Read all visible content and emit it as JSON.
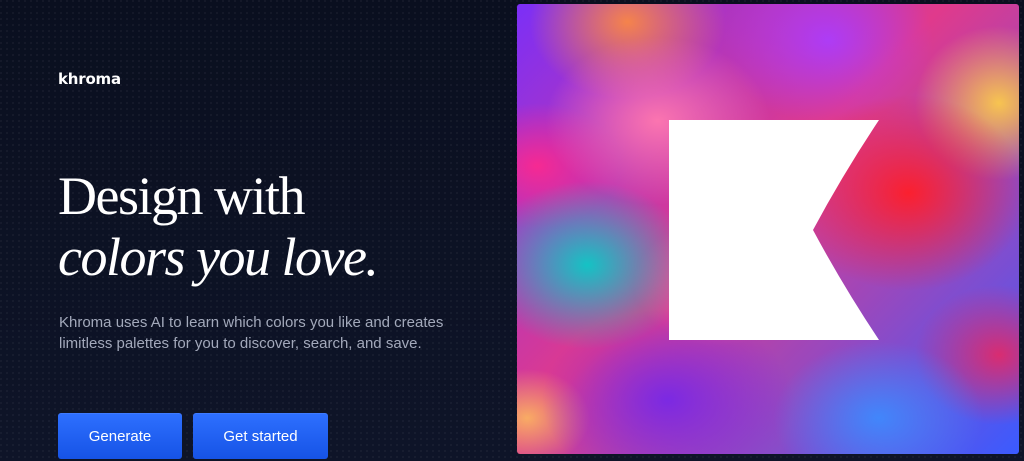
{
  "header": {
    "logo_text": "khroma"
  },
  "hero": {
    "headline_line1": "Design with",
    "headline_line2": "colors you love.",
    "description": "Khroma uses AI to learn which colors you like and creates limitless palettes for you to discover, search, and save.",
    "buttons": {
      "generate_label": "Generate",
      "get_started_label": "Get started"
    }
  },
  "art": {
    "logo_mark_icon": "khroma-k-logo-icon"
  },
  "colors": {
    "background": "#0d1224",
    "accent_button": "#1f5fff",
    "body_text": "#a3a9bb",
    "heading_text": "#ffffff"
  }
}
